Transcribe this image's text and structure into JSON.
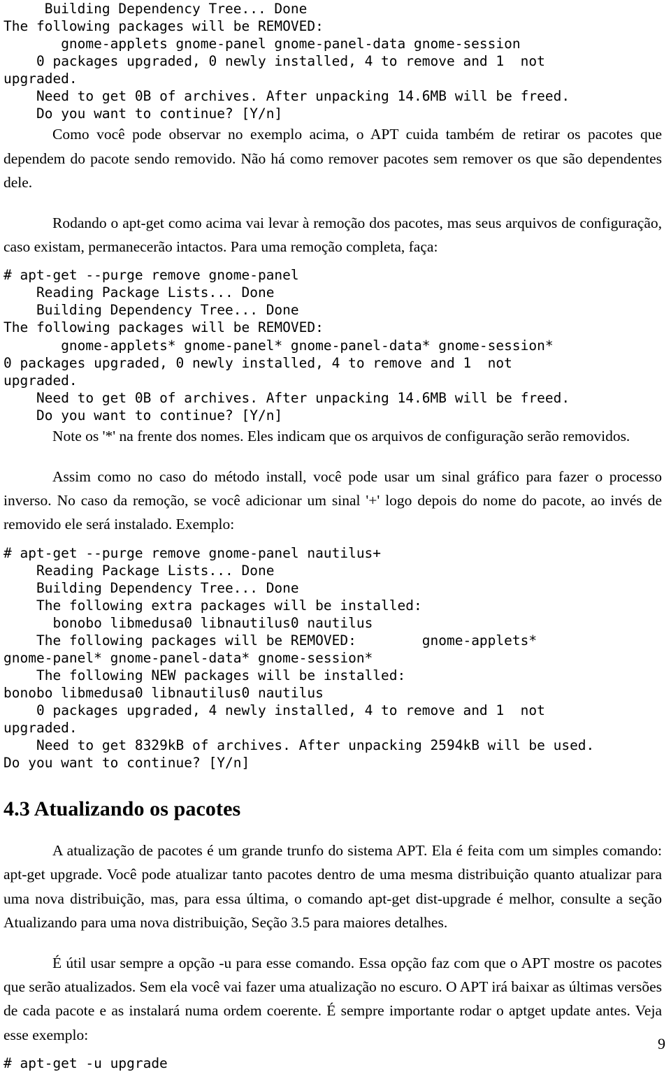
{
  "document": {
    "page_number": "9",
    "section_heading": "4.3 Atualizando os pacotes"
  },
  "code_block_1": {
    "lines": [
      "     Building Dependency Tree... Done",
      "The following packages will be REMOVED:",
      "       gnome-applets gnome-panel gnome-panel-data gnome-session",
      "    0 packages upgraded, 0 newly installed, 4 to remove and 1  not",
      "upgraded.",
      "    Need to get 0B of archives. After unpacking 14.6MB will be freed.",
      "    Do you want to continue? [Y/n]"
    ]
  },
  "paragraph_1": "Como você pode observar no exemplo acima, o APT cuida também de retirar os pacotes que dependem do pacote sendo removido. Não há como remover pacotes sem remover os que são dependentes dele.",
  "paragraph_2": "Rodando o apt-get como acima vai levar à remoção dos pacotes, mas seus arquivos de configuração, caso existam, permanecerão intactos. Para uma remoção completa, faça:",
  "code_block_2": {
    "lines": [
      "# apt-get --purge remove gnome-panel",
      "    Reading Package Lists... Done",
      "    Building Dependency Tree... Done",
      "The following packages will be REMOVED:",
      "       gnome-applets* gnome-panel* gnome-panel-data* gnome-session*",
      "0 packages upgraded, 0 newly installed, 4 to remove and 1  not",
      "upgraded.",
      "    Need to get 0B of archives. After unpacking 14.6MB will be freed.",
      "    Do you want to continue? [Y/n]"
    ]
  },
  "paragraph_3": "Note os '*' na frente dos nomes. Eles indicam que os arquivos de configuração serão removidos.",
  "paragraph_4": "Assim como no caso do método install, você pode usar um sinal gráfico para fazer o processo inverso. No caso da remoção, se você adicionar um sinal '+' logo depois do nome do pacote, ao invés de removido ele será instalado. Exemplo:",
  "code_block_3": {
    "lines": [
      "# apt-get --purge remove gnome-panel nautilus+",
      "    Reading Package Lists... Done",
      "    Building Dependency Tree... Done",
      "    The following extra packages will be installed:",
      "      bonobo libmedusa0 libnautilus0 nautilus",
      "    The following packages will be REMOVED:        gnome-applets*",
      "gnome-panel* gnome-panel-data* gnome-session*",
      "    The following NEW packages will be installed:",
      "bonobo libmedusa0 libnautilus0 nautilus",
      "    0 packages upgraded, 4 newly installed, 4 to remove and 1  not",
      "upgraded.",
      "    Need to get 8329kB of archives. After unpacking 2594kB will be used.",
      "Do you want to continue? [Y/n]"
    ]
  },
  "paragraph_5": "A atualização de pacotes é um grande trunfo do sistema APT. Ela é feita com um simples comando: apt-get upgrade. Você pode atualizar tanto pacotes dentro de uma mesma distribuição quanto atualizar para uma nova distribuição, mas, para essa última, o comando apt-get dist-upgrade é melhor, consulte a seção Atualizando para uma nova distribuição, Seção 3.5 para maiores detalhes.",
  "paragraph_6": "É útil usar sempre a opção -u para esse comando. Essa opção faz com que o APT mostre os pacotes que serão atualizados. Sem ela você vai fazer uma atualização no escuro. O APT irá baixar as últimas versões de cada pacote e as instalará numa ordem coerente. É sempre importante rodar o aptget update antes. Veja esse exemplo:",
  "code_block_4": {
    "lines": [
      "# apt-get -u upgrade"
    ]
  }
}
